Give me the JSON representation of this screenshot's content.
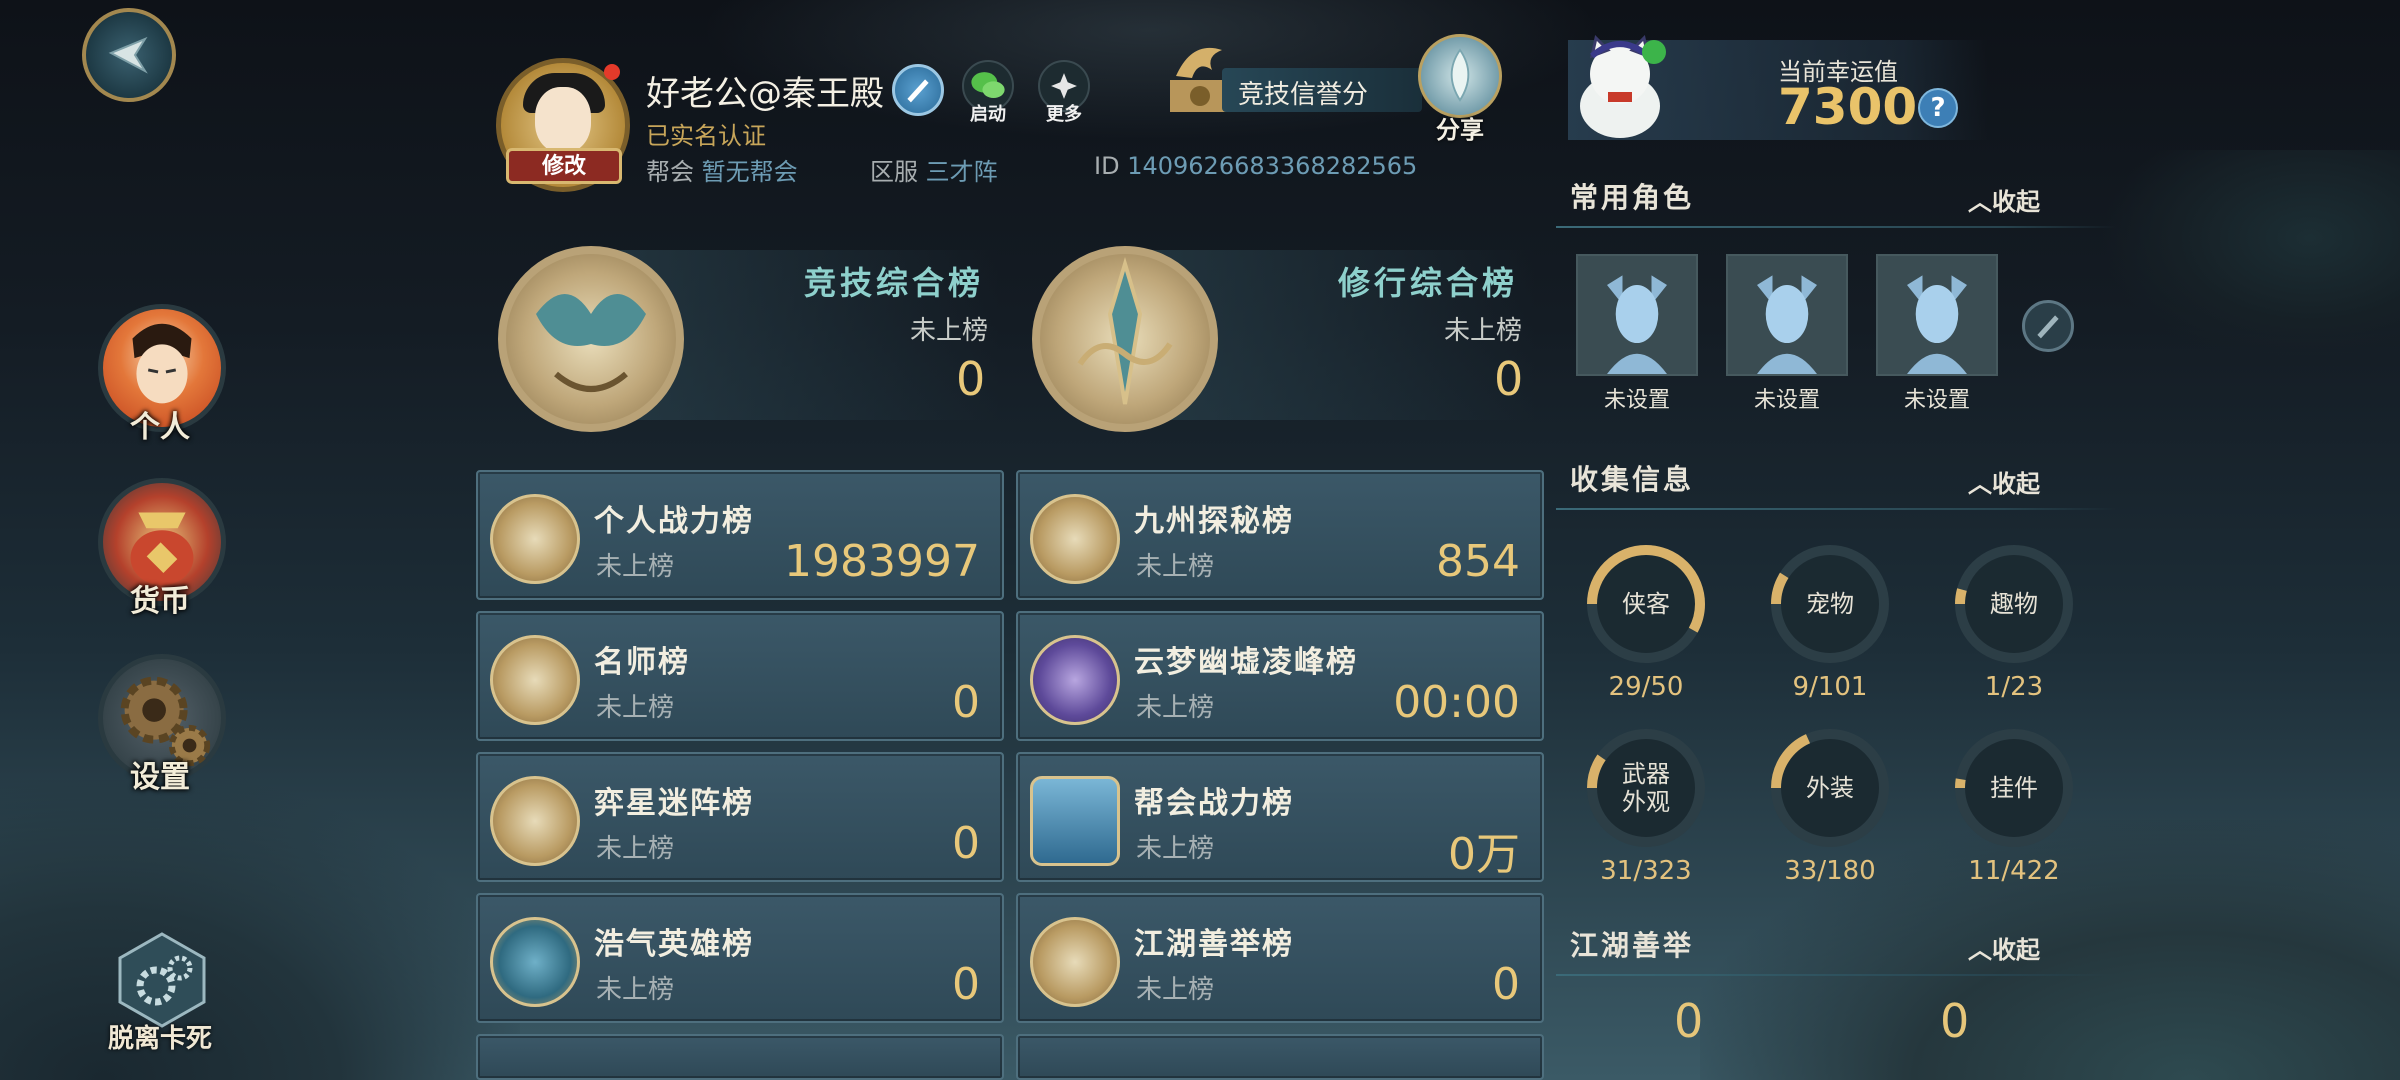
{
  "profile": {
    "username": "好老公@秦王殿",
    "verified": "已实名认证",
    "edit_label": "修改",
    "guild_label": "帮会",
    "guild_value": "暂无帮会",
    "server_label": "区服",
    "server_value": "三才阵",
    "id_label": "ID",
    "id_value": "1409626683368282565",
    "start_label": "启动",
    "more_label": "更多"
  },
  "honor": {
    "label": "竞技信誉分"
  },
  "share": {
    "label": "分享"
  },
  "luck": {
    "title": "当前幸运值",
    "value": "7300",
    "help": "?"
  },
  "sidebar": {
    "personal": "个人",
    "currency": "货币",
    "settings": "设置",
    "escape": "脱离卡死"
  },
  "big_ranks": [
    {
      "title": "竞技综合榜",
      "status": "未上榜",
      "value": "0"
    },
    {
      "title": "修行综合榜",
      "status": "未上榜",
      "value": "0"
    }
  ],
  "ranks": [
    {
      "title": "个人战力榜",
      "status": "未上榜",
      "value": "1983997"
    },
    {
      "title": "九州探秘榜",
      "status": "未上榜",
      "value": "854"
    },
    {
      "title": "名师榜",
      "status": "未上榜",
      "value": "0"
    },
    {
      "title": "云梦幽墟凌峰榜",
      "status": "未上榜",
      "value": "00:00"
    },
    {
      "title": "弈星迷阵榜",
      "status": "未上榜",
      "value": "0"
    },
    {
      "title": "帮会战力榜",
      "status": "未上榜",
      "value": "0万"
    },
    {
      "title": "浩气英雄榜",
      "status": "未上榜",
      "value": "0"
    },
    {
      "title": "江湖善举榜",
      "status": "未上榜",
      "value": "0"
    }
  ],
  "roles": {
    "title": "常用角色",
    "collapse": "收起",
    "slots": [
      "未设置",
      "未设置",
      "未设置"
    ]
  },
  "collection": {
    "title": "收集信息",
    "collapse": "收起",
    "items": [
      {
        "label": "侠客",
        "count": "29/50",
        "fraction": 0.58
      },
      {
        "label": "宠物",
        "count": "9/101",
        "fraction": 0.089
      },
      {
        "label": "趣物",
        "count": "1/23",
        "fraction": 0.043
      },
      {
        "label": "武器\n外观",
        "count": "31/323",
        "fraction": 0.096
      },
      {
        "label": "外装",
        "count": "33/180",
        "fraction": 0.183
      },
      {
        "label": "挂件",
        "count": "11/422",
        "fraction": 0.026
      }
    ]
  },
  "deeds": {
    "title": "江湖善举",
    "collapse": "收起",
    "values": [
      "0",
      "0"
    ]
  },
  "colors": {
    "gold": "#e8c87a",
    "teal_title": "#8ed0cc",
    "ring_fill": "#d9b26a",
    "ring_track": "#2c3e46"
  }
}
